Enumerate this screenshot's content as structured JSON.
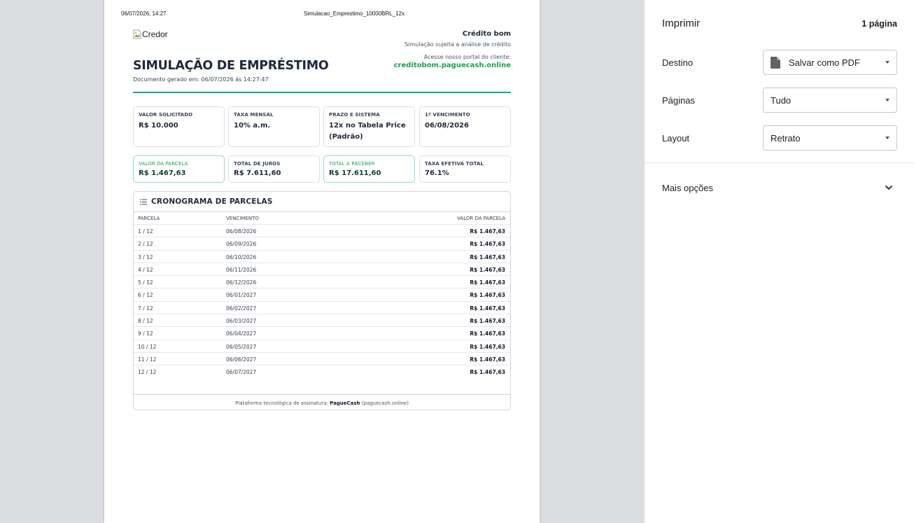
{
  "print_header": {
    "date": "06/07/2026, 14:27",
    "filename": "Simulacao_Emprestimo_10000BRL_12x"
  },
  "document": {
    "logo_alt": "Credor",
    "company_name": "Crédito bom",
    "company_subtitle": "Simulação sujeita a análise de crédito",
    "portal_label": "Acesse nosso portal do cliente:",
    "portal_url": "creditobom.paguecash.online",
    "title": "SIMULAÇÃO DE EMPRÉSTIMO",
    "generated": "Documento gerado em: 06/07/2026 às 14:27:47",
    "summary_row1": [
      {
        "label": "VALOR SOLICITADO",
        "value": "R$ 10.000"
      },
      {
        "label": "TAXA MENSAL",
        "value": "10% a.m."
      },
      {
        "label": "PRAZO E SISTEMA",
        "value": "12x no Tabela Price (Padrão)"
      },
      {
        "label": "1º VENCIMENTO",
        "value": "06/08/2026"
      }
    ],
    "summary_row2": [
      {
        "label": "VALOR DA PARCELA",
        "value": "R$ 1.467,63"
      },
      {
        "label": "TOTAL DE JUROS",
        "value": "R$ 7.611,60"
      },
      {
        "label": "TOTAL A RECEBER",
        "value": "R$ 17.611,60"
      },
      {
        "label": "TAXA EFETIVA TOTAL",
        "value": "76.1%"
      }
    ],
    "schedule": {
      "title": "CRONOGRAMA DE PARCELAS",
      "columns": [
        "PARCELA",
        "VENCIMENTO",
        "VALOR DA PARCELA"
      ],
      "rows": [
        [
          "1 / 12",
          "06/08/2026",
          "R$ 1.467,63"
        ],
        [
          "2 / 12",
          "06/09/2026",
          "R$ 1.467,63"
        ],
        [
          "3 / 12",
          "06/10/2026",
          "R$ 1.467,63"
        ],
        [
          "4 / 12",
          "06/11/2026",
          "R$ 1.467,63"
        ],
        [
          "5 / 12",
          "06/12/2026",
          "R$ 1.467,63"
        ],
        [
          "6 / 12",
          "06/01/2027",
          "R$ 1.467,63"
        ],
        [
          "7 / 12",
          "06/02/2027",
          "R$ 1.467,63"
        ],
        [
          "8 / 12",
          "06/03/2027",
          "R$ 1.467,63"
        ],
        [
          "9 / 12",
          "06/04/2027",
          "R$ 1.467,63"
        ],
        [
          "10 / 12",
          "06/05/2027",
          "R$ 1.467,63"
        ],
        [
          "11 / 12",
          "06/06/2027",
          "R$ 1.467,63"
        ],
        [
          "12 / 12",
          "06/07/2027",
          "R$ 1.467,63"
        ]
      ],
      "footer_prefix": "Plataforma tecnológica de assinatura: ",
      "footer_brand": "PagueCash",
      "footer_suffix": " (paguecash.online)"
    }
  },
  "print_panel": {
    "title": "Imprimir",
    "page_count": "1 página",
    "destination_label": "Destino",
    "destination_value": "Salvar como PDF",
    "pages_label": "Páginas",
    "pages_value": "Tudo",
    "layout_label": "Layout",
    "layout_value": "Retrato",
    "more_options": "Mais opções"
  },
  "colors": {
    "accent_green": "#16a34a",
    "rule_green": "#1aa879",
    "highlight_border": "#86e3bf",
    "preview_background": "#dcdde1"
  }
}
